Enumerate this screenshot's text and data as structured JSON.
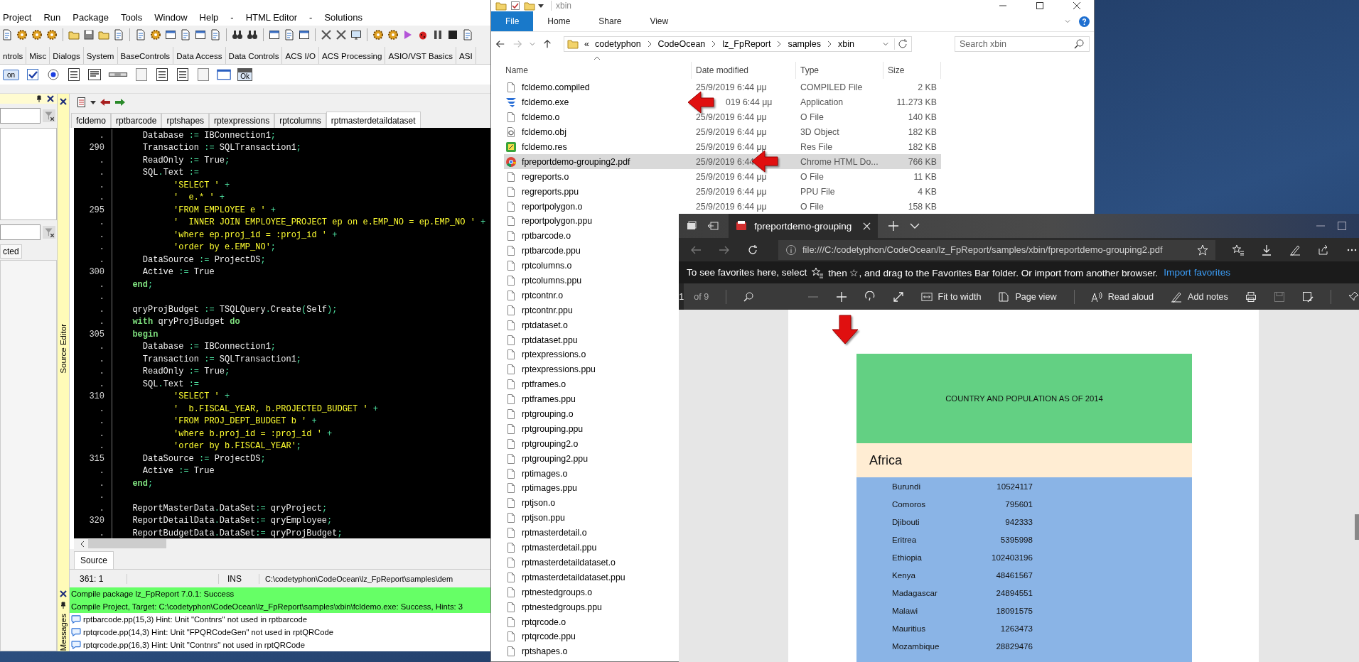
{
  "ide": {
    "menu": [
      "Project",
      "Run",
      "Package",
      "Tools",
      "Window",
      "Help",
      "-",
      "HTML Editor",
      "-",
      "Solutions"
    ],
    "component_tabs": [
      {
        "label": "ntrols",
        "selected": false
      },
      {
        "label": "Misc",
        "selected": false
      },
      {
        "label": "Dialogs",
        "selected": false
      },
      {
        "label": "System",
        "selected": false
      },
      {
        "label": "BaseControls",
        "selected": false
      },
      {
        "label": "Data Access",
        "selected": false
      },
      {
        "label": "Data Controls",
        "selected": false
      },
      {
        "label": "ACS I/O",
        "selected": false
      },
      {
        "label": "ACS Processing",
        "selected": false
      },
      {
        "label": "ASIO/VST Basics",
        "selected": false
      },
      {
        "label": "ASI",
        "selected": false
      }
    ],
    "palette": {
      "toggle_label": "on",
      "form_label": "Ok"
    },
    "inspector": {
      "tab_label": "cted"
    },
    "editor_label": "Source Editor",
    "editor_tabs": [
      {
        "label": "fcldemo",
        "selected": false
      },
      {
        "label": "rptbarcode",
        "selected": false
      },
      {
        "label": "rptshapes",
        "selected": false
      },
      {
        "label": "rptexpressions",
        "selected": false
      },
      {
        "label": "rptcolumns",
        "selected": false
      },
      {
        "label": "rptmasterdetaildataset",
        "selected": true
      }
    ],
    "code_lines": [
      {
        "num": ".",
        "tokens": [
          {
            "kind": "id",
            "text": "    Database "
          },
          {
            "kind": "sym",
            "text": ":= "
          },
          {
            "kind": "id",
            "text": "IBConnection1"
          },
          {
            "kind": "sym",
            "text": ";"
          }
        ]
      },
      {
        "num": "290",
        "tokens": [
          {
            "kind": "id",
            "text": "    Transaction "
          },
          {
            "kind": "sym",
            "text": ":= "
          },
          {
            "kind": "id",
            "text": "SQLTransaction1"
          },
          {
            "kind": "sym",
            "text": ";"
          }
        ]
      },
      {
        "num": ".",
        "tokens": [
          {
            "kind": "id",
            "text": "    ReadOnly "
          },
          {
            "kind": "sym",
            "text": ":= "
          },
          {
            "kind": "id",
            "text": "True"
          },
          {
            "kind": "sym",
            "text": ";"
          }
        ]
      },
      {
        "num": ".",
        "tokens": [
          {
            "kind": "id",
            "text": "    SQL"
          },
          {
            "kind": "sym",
            "text": "."
          },
          {
            "kind": "id",
            "text": "Text "
          },
          {
            "kind": "sym",
            "text": ":="
          }
        ]
      },
      {
        "num": ".",
        "tokens": [
          {
            "kind": "str",
            "text": "          'SELECT ' "
          },
          {
            "kind": "sym",
            "text": "+"
          }
        ]
      },
      {
        "num": ".",
        "tokens": [
          {
            "kind": "str",
            "text": "          '  e.* ' "
          },
          {
            "kind": "sym",
            "text": "+"
          }
        ]
      },
      {
        "num": "295",
        "tokens": [
          {
            "kind": "str",
            "text": "          'FROM EMPLOYEE e ' "
          },
          {
            "kind": "sym",
            "text": "+"
          }
        ]
      },
      {
        "num": ".",
        "tokens": [
          {
            "kind": "str",
            "text": "          '  INNER JOIN EMPLOYEE_PROJECT ep on e.EMP_NO = ep.EMP_NO ' "
          },
          {
            "kind": "sym",
            "text": "+"
          }
        ]
      },
      {
        "num": ".",
        "tokens": [
          {
            "kind": "str",
            "text": "          'where ep.proj_id = :proj_id ' "
          },
          {
            "kind": "sym",
            "text": "+"
          }
        ]
      },
      {
        "num": ".",
        "tokens": [
          {
            "kind": "str",
            "text": "          'order by e.EMP_NO'"
          },
          {
            "kind": "sym",
            "text": ";"
          }
        ]
      },
      {
        "num": ".",
        "tokens": [
          {
            "kind": "id",
            "text": "    DataSource "
          },
          {
            "kind": "sym",
            "text": ":= "
          },
          {
            "kind": "id",
            "text": "ProjectDS"
          },
          {
            "kind": "sym",
            "text": ";"
          }
        ]
      },
      {
        "num": "300",
        "tokens": [
          {
            "kind": "id",
            "text": "    Active "
          },
          {
            "kind": "sym",
            "text": ":= "
          },
          {
            "kind": "id",
            "text": "True"
          }
        ]
      },
      {
        "num": ".",
        "tokens": [
          {
            "kind": "kw",
            "text": "  end"
          },
          {
            "kind": "sym",
            "text": ";"
          }
        ]
      },
      {
        "num": "."
      },
      {
        "num": ".",
        "tokens": [
          {
            "kind": "id",
            "text": "  qryProjBudget "
          },
          {
            "kind": "sym",
            "text": ":= "
          },
          {
            "kind": "id",
            "text": "TSQLQuery"
          },
          {
            "kind": "sym",
            "text": "."
          },
          {
            "kind": "id",
            "text": "Create"
          },
          {
            "kind": "sym",
            "text": "("
          },
          {
            "kind": "id",
            "text": "Self"
          },
          {
            "kind": "sym",
            "text": ");"
          }
        ]
      },
      {
        "num": ".",
        "tokens": [
          {
            "kind": "kw",
            "text": "  with "
          },
          {
            "kind": "id",
            "text": "qryProjBudget "
          },
          {
            "kind": "kw",
            "text": "do"
          }
        ]
      },
      {
        "num": "305",
        "tokens": [
          {
            "kind": "kw",
            "text": "  begin"
          }
        ]
      },
      {
        "num": ".",
        "tokens": [
          {
            "kind": "id",
            "text": "    Database "
          },
          {
            "kind": "sym",
            "text": ":= "
          },
          {
            "kind": "id",
            "text": "IBConnection1"
          },
          {
            "kind": "sym",
            "text": ";"
          }
        ]
      },
      {
        "num": ".",
        "tokens": [
          {
            "kind": "id",
            "text": "    Transaction "
          },
          {
            "kind": "sym",
            "text": ":= "
          },
          {
            "kind": "id",
            "text": "SQLTransaction1"
          },
          {
            "kind": "sym",
            "text": ";"
          }
        ]
      },
      {
        "num": ".",
        "tokens": [
          {
            "kind": "id",
            "text": "    ReadOnly "
          },
          {
            "kind": "sym",
            "text": ":= "
          },
          {
            "kind": "id",
            "text": "True"
          },
          {
            "kind": "sym",
            "text": ";"
          }
        ]
      },
      {
        "num": ".",
        "tokens": [
          {
            "kind": "id",
            "text": "    SQL"
          },
          {
            "kind": "sym",
            "text": "."
          },
          {
            "kind": "id",
            "text": "Text "
          },
          {
            "kind": "sym",
            "text": ":="
          }
        ]
      },
      {
        "num": "310",
        "tokens": [
          {
            "kind": "str",
            "text": "          'SELECT ' "
          },
          {
            "kind": "sym",
            "text": "+"
          }
        ]
      },
      {
        "num": ".",
        "tokens": [
          {
            "kind": "str",
            "text": "          '  b.FISCAL_YEAR, b.PROJECTED_BUDGET ' "
          },
          {
            "kind": "sym",
            "text": "+"
          }
        ]
      },
      {
        "num": ".",
        "tokens": [
          {
            "kind": "str",
            "text": "          'FROM PROJ_DEPT_BUDGET b ' "
          },
          {
            "kind": "sym",
            "text": "+"
          }
        ]
      },
      {
        "num": ".",
        "tokens": [
          {
            "kind": "str",
            "text": "          'where b.proj_id = :proj_id ' "
          },
          {
            "kind": "sym",
            "text": "+"
          }
        ]
      },
      {
        "num": ".",
        "tokens": [
          {
            "kind": "str",
            "text": "          'order by b.FISCAL_YEAR'"
          },
          {
            "kind": "sym",
            "text": ";"
          }
        ]
      },
      {
        "num": "315",
        "tokens": [
          {
            "kind": "id",
            "text": "    DataSource "
          },
          {
            "kind": "sym",
            "text": ":= "
          },
          {
            "kind": "id",
            "text": "ProjectDS"
          },
          {
            "kind": "sym",
            "text": ";"
          }
        ]
      },
      {
        "num": ".",
        "tokens": [
          {
            "kind": "id",
            "text": "    Active "
          },
          {
            "kind": "sym",
            "text": ":= "
          },
          {
            "kind": "id",
            "text": "True"
          }
        ]
      },
      {
        "num": ".",
        "tokens": [
          {
            "kind": "kw",
            "text": "  end"
          },
          {
            "kind": "sym",
            "text": ";"
          }
        ]
      },
      {
        "num": "."
      },
      {
        "num": ".",
        "tokens": [
          {
            "kind": "id",
            "text": "  ReportMasterData"
          },
          {
            "kind": "sym",
            "text": "."
          },
          {
            "kind": "id",
            "text": "DataSet"
          },
          {
            "kind": "sym",
            "text": ":= "
          },
          {
            "kind": "id",
            "text": "qryProject"
          },
          {
            "kind": "sym",
            "text": ";"
          }
        ]
      },
      {
        "num": "320",
        "tokens": [
          {
            "kind": "id",
            "text": "  ReportDetailData"
          },
          {
            "kind": "sym",
            "text": "."
          },
          {
            "kind": "id",
            "text": "DataSet"
          },
          {
            "kind": "sym",
            "text": ":= "
          },
          {
            "kind": "id",
            "text": "qryEmployee"
          },
          {
            "kind": "sym",
            "text": ";"
          }
        ]
      },
      {
        "num": ".",
        "tokens": [
          {
            "kind": "id",
            "text": "  ReportBudgetData"
          },
          {
            "kind": "sym",
            "text": "."
          },
          {
            "kind": "id",
            "text": "DataSet"
          },
          {
            "kind": "sym",
            "text": ":= "
          },
          {
            "kind": "id",
            "text": "qryProjBudget"
          },
          {
            "kind": "sym",
            "text": ";"
          }
        ]
      }
    ],
    "source_tab": "Source",
    "status": {
      "position": "361:  1",
      "mode": "INS",
      "path": "C:\\codetyphon\\CodeOcean\\lz_FpReport\\samples\\dem"
    },
    "messages_label": "Messages",
    "messages": [
      {
        "kind": "success",
        "text": "Compile package lz_FpReport 7.0.1: Success"
      },
      {
        "kind": "success",
        "text": "Compile Project, Target: C:\\codetyphon\\CodeOcean\\lz_FpReport\\samples\\xbin\\fcldemo.exe: Success, Hints: 3"
      },
      {
        "kind": "hint",
        "text": "rptbarcode.pp(15,3) Hint: Unit \"Contnrs\" not used in rptbarcode"
      },
      {
        "kind": "hint",
        "text": "rptqrcode.pp(14,3) Hint: Unit \"FPQRCodeGen\" not used in rptQRCode"
      },
      {
        "kind": "hint",
        "text": "rptqrcode.pp(16,3) Hint: Unit \"Contnrs\" not used in rptQRCode"
      }
    ]
  },
  "explorer": {
    "title": "xbin",
    "ribbon_tabs": [
      {
        "label": "File",
        "selected": true
      },
      {
        "label": "Home",
        "selected": false
      },
      {
        "label": "Share",
        "selected": false
      },
      {
        "label": "View",
        "selected": false
      }
    ],
    "breadcrumb": [
      "«",
      "codetyphon",
      "CodeOcean",
      "lz_FpReport",
      "samples",
      "xbin"
    ],
    "search": {
      "placeholder": "Search xbin"
    },
    "columns": [
      "Name",
      "Date modified",
      "Type",
      "Size"
    ],
    "files": [
      {
        "name": "fcldemo.compiled",
        "kind": "file",
        "date": "25/9/2019 6:44 μμ",
        "type": "COMPILED File",
        "size": "2 KB",
        "selected": false
      },
      {
        "name": "fcldemo.exe",
        "kind": "exe",
        "date": "019 6:44 μμ",
        "type": "Application",
        "size": "11.273 KB",
        "selected": false
      },
      {
        "name": "fcldemo.o",
        "kind": "file",
        "date": "25/9/2019 6:44 μμ",
        "type": "O File",
        "size": "140 KB",
        "selected": false
      },
      {
        "name": "fcldemo.obj",
        "kind": "obj",
        "date": "25/9/2019 6:44 μμ",
        "type": "3D Object",
        "size": "182 KB",
        "selected": false
      },
      {
        "name": "fcldemo.res",
        "kind": "res",
        "date": "25/9/2019 6:44 μμ",
        "type": "Res File",
        "size": "182 KB",
        "selected": false
      },
      {
        "name": "fpreportdemo-grouping2.pdf",
        "kind": "chrome",
        "date": "25/9/2019 6:44",
        "type": "Chrome HTML Do...",
        "size": "766 KB",
        "selected": true
      },
      {
        "name": "regreports.o",
        "kind": "file",
        "date": "25/9/2019 6:44 μμ",
        "type": "O File",
        "size": "11 KB",
        "selected": false
      },
      {
        "name": "regreports.ppu",
        "kind": "file",
        "date": "25/9/2019 6:44 μμ",
        "type": "PPU File",
        "size": "4 KB",
        "selected": false
      },
      {
        "name": "reportpolygon.o",
        "kind": "file",
        "date": "25/9/2019 6:44 μμ",
        "type": "O File",
        "size": "158 KB",
        "selected": false
      },
      {
        "name": "reportpolygon.ppu",
        "kind": "file",
        "selected": false
      },
      {
        "name": "rptbarcode.o",
        "kind": "file",
        "selected": false
      },
      {
        "name": "rptbarcode.ppu",
        "kind": "file",
        "selected": false
      },
      {
        "name": "rptcolumns.o",
        "kind": "file",
        "selected": false
      },
      {
        "name": "rptcolumns.ppu",
        "kind": "file",
        "selected": false
      },
      {
        "name": "rptcontnr.o",
        "kind": "file",
        "selected": false
      },
      {
        "name": "rptcontnr.ppu",
        "kind": "file",
        "selected": false
      },
      {
        "name": "rptdataset.o",
        "kind": "file",
        "selected": false
      },
      {
        "name": "rptdataset.ppu",
        "kind": "file",
        "selected": false
      },
      {
        "name": "rptexpressions.o",
        "kind": "file",
        "selected": false
      },
      {
        "name": "rptexpressions.ppu",
        "kind": "file",
        "selected": false
      },
      {
        "name": "rptframes.o",
        "kind": "file",
        "selected": false
      },
      {
        "name": "rptframes.ppu",
        "kind": "file",
        "selected": false
      },
      {
        "name": "rptgrouping.o",
        "kind": "file",
        "selected": false
      },
      {
        "name": "rptgrouping.ppu",
        "kind": "file",
        "selected": false
      },
      {
        "name": "rptgrouping2.o",
        "kind": "file",
        "selected": false
      },
      {
        "name": "rptgrouping2.ppu",
        "kind": "file",
        "selected": false
      },
      {
        "name": "rptimages.o",
        "kind": "file",
        "selected": false
      },
      {
        "name": "rptimages.ppu",
        "kind": "file",
        "selected": false
      },
      {
        "name": "rptjson.o",
        "kind": "file",
        "selected": false
      },
      {
        "name": "rptjson.ppu",
        "kind": "file",
        "selected": false
      },
      {
        "name": "rptmasterdetail.o",
        "kind": "file",
        "selected": false
      },
      {
        "name": "rptmasterdetail.ppu",
        "kind": "file",
        "selected": false
      },
      {
        "name": "rptmasterdetaildataset.o",
        "kind": "file",
        "selected": false
      },
      {
        "name": "rptmasterdetaildataset.ppu",
        "kind": "file",
        "selected": false
      },
      {
        "name": "rptnestedgroups.o",
        "kind": "file",
        "selected": false
      },
      {
        "name": "rptnestedgroups.ppu",
        "kind": "file",
        "selected": false
      },
      {
        "name": "rptqrcode.o",
        "kind": "file",
        "selected": false
      },
      {
        "name": "rptqrcode.ppu",
        "kind": "file",
        "selected": false
      },
      {
        "name": "rptshapes.o",
        "kind": "file",
        "selected": false
      }
    ]
  },
  "browser": {
    "tab_title": "fpreportdemo-grouping",
    "url": "file:///C:/codetyphon/CodeOcean/lz_FpReport/samples/xbin/fpreportdemo-grouping2.pdf",
    "favorites_hint_start": "To see favorites here, select",
    "favorites_hint_end": "then ☆, and drag to the Favorites Bar folder. Or import from another browser.",
    "favorites_link": "Import favorites",
    "pdf_toolbar": {
      "page": "1",
      "page_count": "of 9",
      "tools": [
        {
          "label": "Fit to width"
        },
        {
          "label": "Page view"
        },
        {
          "label": "Read aloud"
        },
        {
          "label": "Add notes"
        }
      ]
    },
    "report": {
      "title": "COUNTRY AND POPULATION AS OF 2014",
      "group": "Africa",
      "rows": [
        {
          "country": "Burundi",
          "population": "10524117"
        },
        {
          "country": "Comoros",
          "population": "795601"
        },
        {
          "country": "Djibouti",
          "population": "942333"
        },
        {
          "country": "Eritrea",
          "population": "5395998"
        },
        {
          "country": "Ethiopia",
          "population": "102403196"
        },
        {
          "country": "Kenya",
          "population": "48461567"
        },
        {
          "country": "Madagascar",
          "population": "24894551"
        },
        {
          "country": "Malawi",
          "population": "18091575"
        },
        {
          "country": "Mauritius",
          "population": "1263473"
        },
        {
          "country": "Mozambique",
          "population": "28829476"
        }
      ]
    }
  }
}
